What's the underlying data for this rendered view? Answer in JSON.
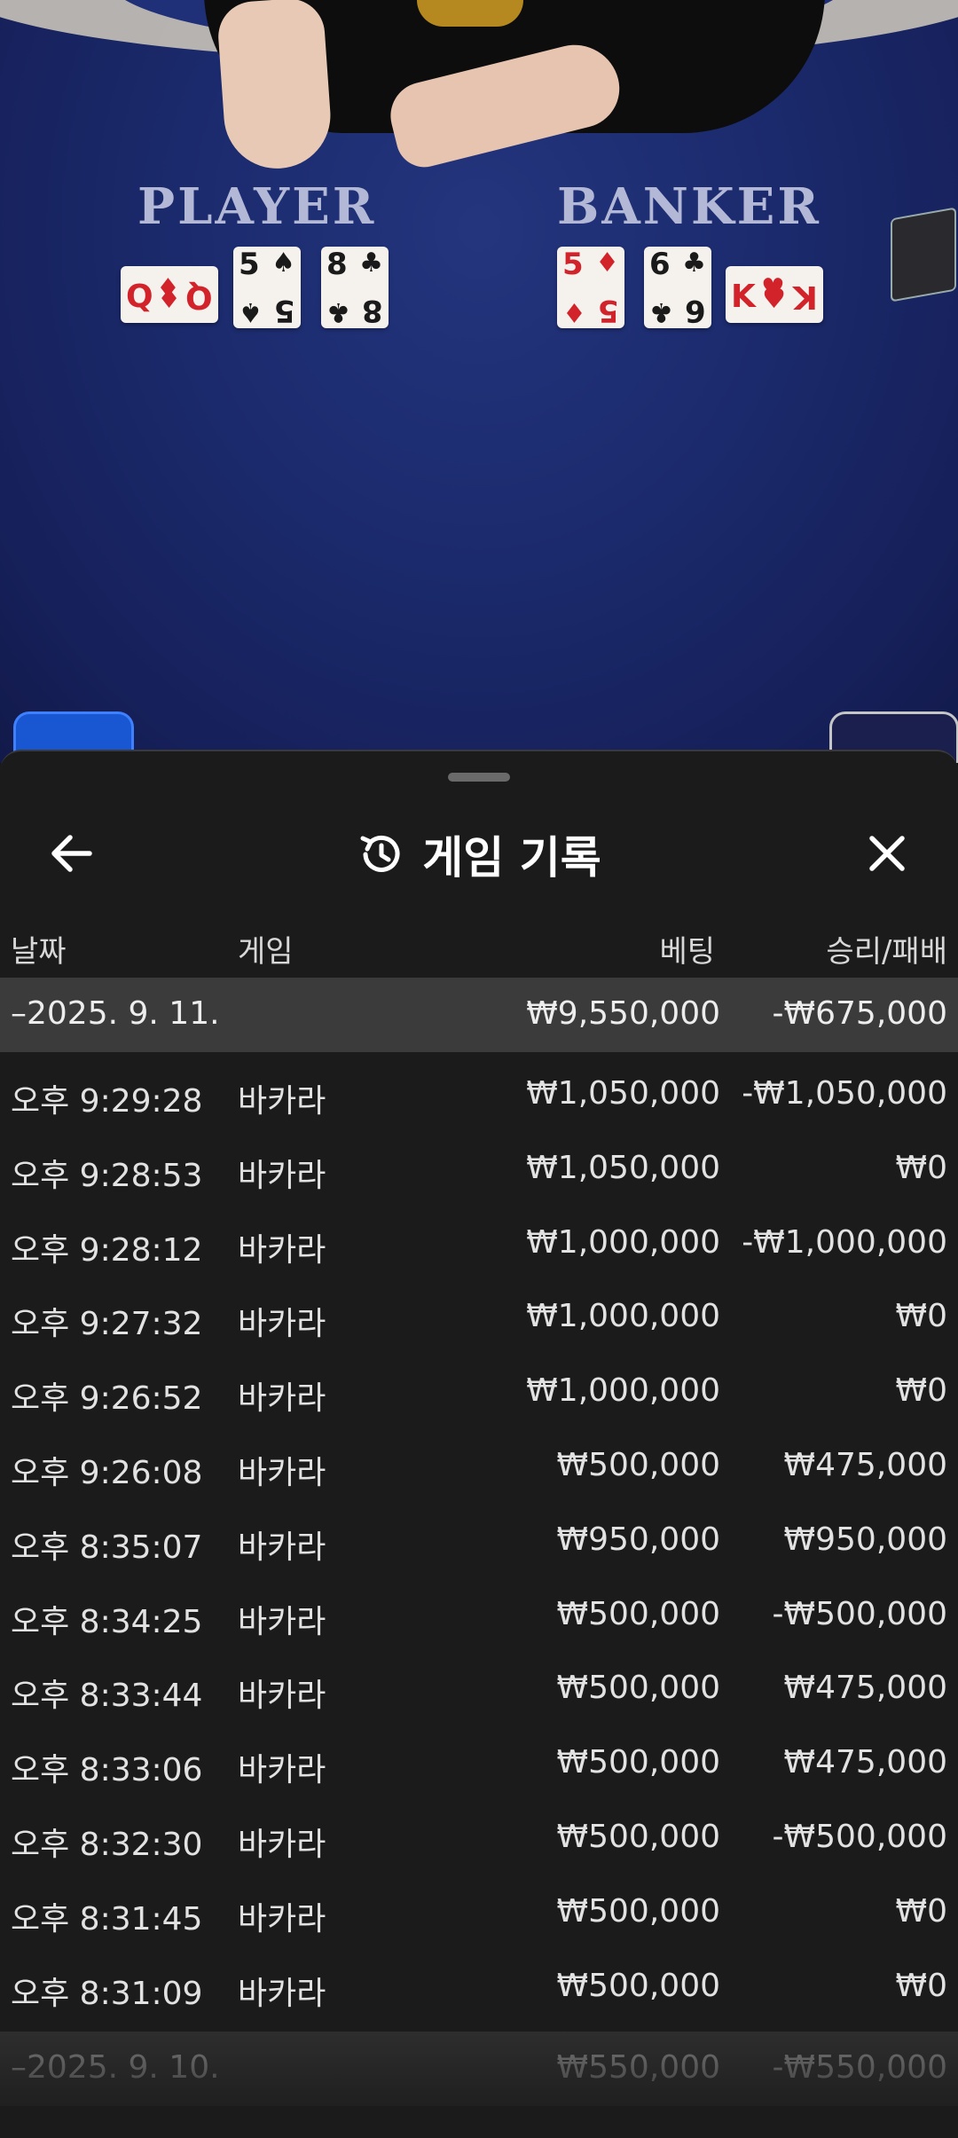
{
  "stream": {
    "player_label": "PLAYER",
    "banker_label": "BANKER",
    "player_cards": [
      {
        "rank": "Q",
        "suit": "♦",
        "color": "red"
      },
      {
        "rank": "5",
        "suit": "♠",
        "color": "black"
      },
      {
        "rank": "8",
        "suit": "♣",
        "color": "black"
      }
    ],
    "banker_cards": [
      {
        "rank": "5",
        "suit": "♦",
        "color": "red"
      },
      {
        "rank": "6",
        "suit": "♣",
        "color": "black"
      },
      {
        "rank": "K",
        "suit": "♥",
        "color": "red"
      }
    ]
  },
  "sheet": {
    "title": "게임 기록",
    "icons": {
      "back": "arrow-left-icon",
      "history": "history-icon",
      "close": "close-icon"
    },
    "columns": {
      "date": "날짜",
      "game": "게임",
      "bet": "베팅",
      "result": "승리/패배"
    },
    "groups": [
      {
        "date": "–2025. 9. 11.",
        "bet": "₩9,550,000",
        "result": "-₩675,000",
        "rows": [
          {
            "time": "오후 9:29:28",
            "game": "바카라",
            "bet": "₩1,050,000",
            "result": "-₩1,050,000"
          },
          {
            "time": "오후 9:28:53",
            "game": "바카라",
            "bet": "₩1,050,000",
            "result": "₩0"
          },
          {
            "time": "오후 9:28:12",
            "game": "바카라",
            "bet": "₩1,000,000",
            "result": "-₩1,000,000"
          },
          {
            "time": "오후 9:27:32",
            "game": "바카라",
            "bet": "₩1,000,000",
            "result": "₩0"
          },
          {
            "time": "오후 9:26:52",
            "game": "바카라",
            "bet": "₩1,000,000",
            "result": "₩0"
          },
          {
            "time": "오후 9:26:08",
            "game": "바카라",
            "bet": "₩500,000",
            "result": "₩475,000"
          },
          {
            "time": "오후 8:35:07",
            "game": "바카라",
            "bet": "₩950,000",
            "result": "₩950,000"
          },
          {
            "time": "오후 8:34:25",
            "game": "바카라",
            "bet": "₩500,000",
            "result": "-₩500,000"
          },
          {
            "time": "오후 8:33:44",
            "game": "바카라",
            "bet": "₩500,000",
            "result": "₩475,000"
          },
          {
            "time": "오후 8:33:06",
            "game": "바카라",
            "bet": "₩500,000",
            "result": "₩475,000"
          },
          {
            "time": "오후 8:32:30",
            "game": "바카라",
            "bet": "₩500,000",
            "result": "-₩500,000"
          },
          {
            "time": "오후 8:31:45",
            "game": "바카라",
            "bet": "₩500,000",
            "result": "₩0"
          },
          {
            "time": "오후 8:31:09",
            "game": "바카라",
            "bet": "₩500,000",
            "result": "₩0"
          }
        ]
      },
      {
        "date": "–2025. 9. 10.",
        "bet": "₩550,000",
        "result": "-₩550,000"
      }
    ]
  },
  "colors": {
    "sheet_bg": "#1b1b1b",
    "group_bg": "#3b3b3b",
    "felt": "#1b2a6c"
  }
}
